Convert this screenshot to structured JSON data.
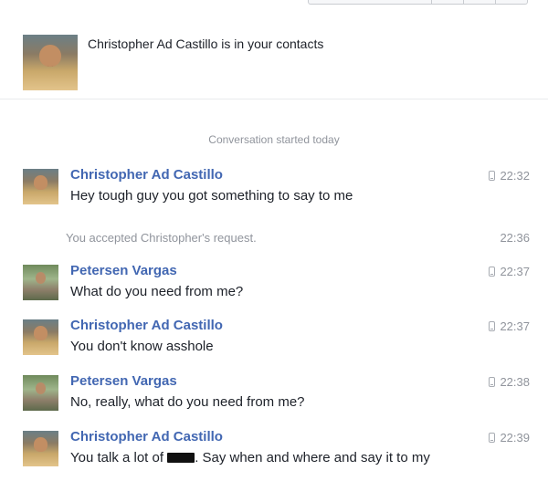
{
  "contact_notice": {
    "text": "Christopher Ad Castillo is in your contacts"
  },
  "conversation": {
    "started_label": "Conversation started today",
    "accepted_notice": {
      "text": "You accepted Christopher's request.",
      "time": "22:36"
    },
    "messages": [
      {
        "sender": "Christopher Ad Castillo",
        "text": "Hey tough guy you got something to say to me",
        "time": "22:32"
      },
      {
        "sender": "Petersen Vargas",
        "text": "What do you need from me?",
        "time": "22:37"
      },
      {
        "sender": "Christopher Ad Castillo",
        "text": "You don't know asshole",
        "time": "22:37"
      },
      {
        "sender": "Petersen Vargas",
        "text": "No, really, what do you need from me?",
        "time": "22:38"
      },
      {
        "sender": "Christopher Ad Castillo",
        "text_before": "You talk a lot of",
        "text_after": ". Say when and where and say it to my",
        "time": "22:39"
      }
    ]
  },
  "icons": {
    "mobile": "mobile-phone-icon"
  },
  "colors": {
    "sender_name": "#4267b2",
    "meta_text": "#90949c",
    "body_text": "#1d2129"
  }
}
